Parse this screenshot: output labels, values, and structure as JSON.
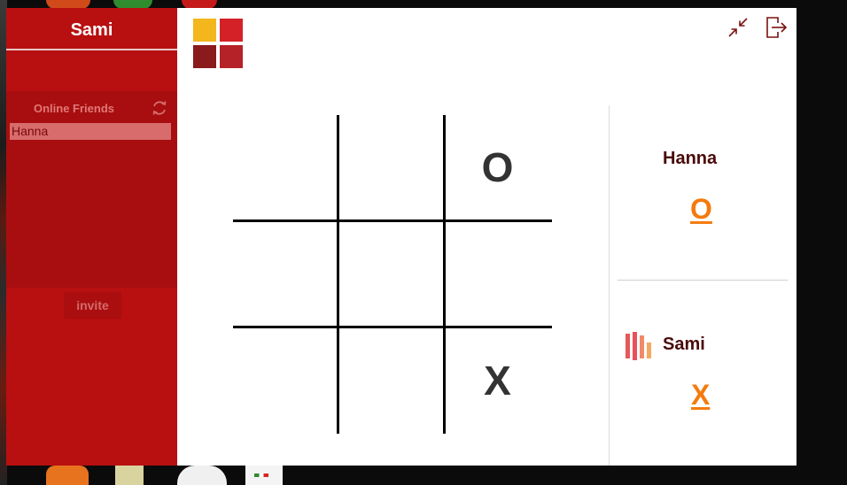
{
  "sidebar": {
    "username": "Sami",
    "friends_header": "Online Friends",
    "friends": [
      {
        "name": "Hanna"
      }
    ],
    "invite_label": "invite"
  },
  "board": {
    "cells": [
      "",
      "",
      "O",
      "",
      "",
      "",
      "",
      "",
      "X"
    ]
  },
  "players": [
    {
      "name": "Hanna",
      "symbol": "O",
      "active": false
    },
    {
      "name": "Sami",
      "symbol": "X",
      "active": true
    }
  ],
  "icons": {
    "refresh": "refresh-icon",
    "minimize": "minimize-icon",
    "exit": "exit-icon",
    "logo": "logo-icon",
    "turn": "turn-indicator-icon"
  },
  "colors": {
    "sidebar": "#b80f10",
    "friends_panel": "#a80e0f",
    "friend_selected": "#d86c6c",
    "symbol": "#f47b0e",
    "player_name": "#4a0a0a",
    "logo": [
      "#f3b61c",
      "#d42127",
      "#8a1a1c",
      "#b52228"
    ]
  }
}
